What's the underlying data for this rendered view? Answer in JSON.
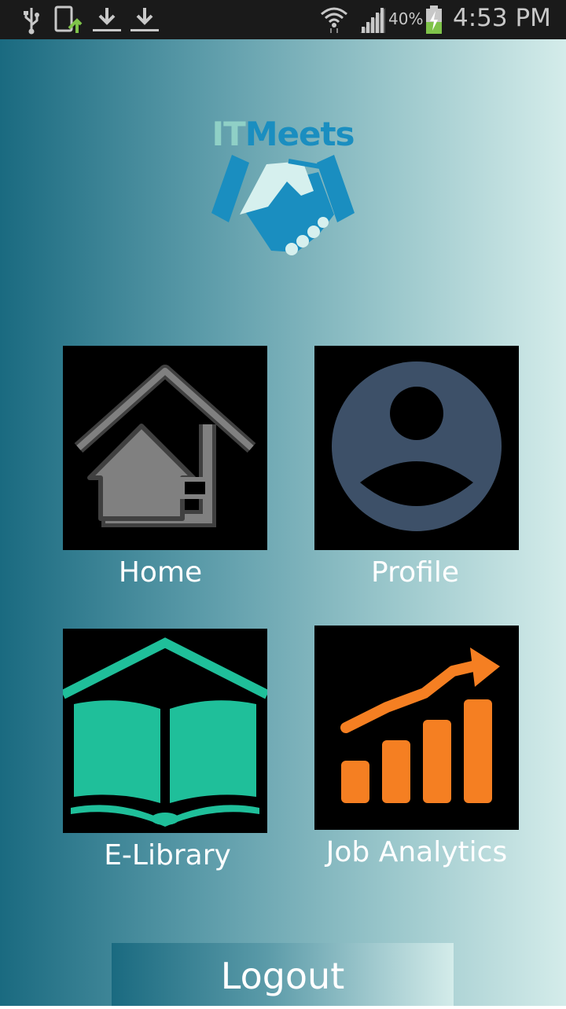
{
  "status_bar": {
    "battery_percent": "40%",
    "time": "4:53 PM",
    "icons": [
      "usb-icon",
      "phone-update-icon",
      "download-icon",
      "download-icon",
      "wifi-icon",
      "signal-icon",
      "battery-charging-icon"
    ]
  },
  "logo": {
    "text_part1": "IT",
    "text_part2": "Meets",
    "icon": "handshake-icon",
    "colors": {
      "it": "#8fd0c6",
      "meets": "#1a8ec0"
    }
  },
  "menu": {
    "home_label": "Home",
    "profile_label": "Profile",
    "elibrary_label": "E-Library",
    "job_analytics_label": "Job Analytics",
    "icons": [
      "home-icon",
      "profile-icon",
      "book-icon",
      "growth-chart-icon"
    ],
    "colors": {
      "home": "#808080",
      "profile": "#3d5068",
      "elibrary": "#1fbf9a",
      "job_analytics": "#f57f22"
    }
  },
  "logout_label": "Logout"
}
